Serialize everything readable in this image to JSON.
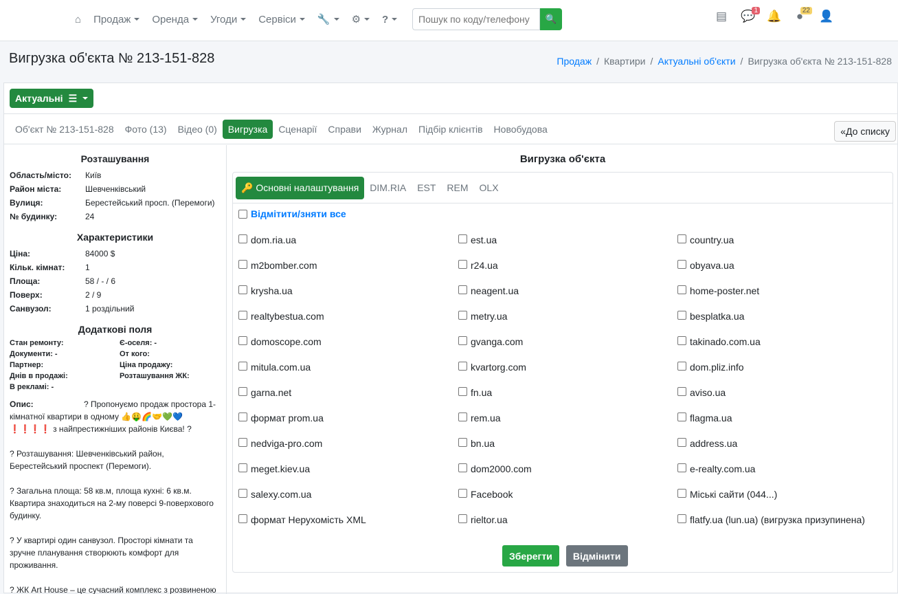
{
  "nav": {
    "items": [
      "Продаж",
      "Оренда",
      "Угоди",
      "Сервіси"
    ],
    "search_placeholder": "Пошук по коду/телефону",
    "messages_badge": "1",
    "tasks_badge": "22"
  },
  "page": {
    "title": "Вигрузка об'єкта № 213-151-828"
  },
  "breadcrumb": [
    "Продаж",
    "Квартири",
    "Актуальні об'єкти",
    "Вигрузка об'єкта № 213-151-828"
  ],
  "status_button": "Актуальні",
  "tabs": [
    "Об'єкт № 213-151-828",
    "Фото (13)",
    "Відео (0)",
    "Вигрузка",
    "Сценарії",
    "Справи",
    "Журнал",
    "Підбір клієнтів",
    "Новобудова"
  ],
  "back_button": "До списку",
  "left": {
    "location_title": "Розташування",
    "location": [
      [
        "Область/місто:",
        "Київ"
      ],
      [
        "Район міста:",
        "Шевченківський"
      ],
      [
        "Вулиця:",
        "Берестейський просп. (Перемоги)"
      ],
      [
        "№ будинку:",
        "24"
      ]
    ],
    "specs_title": "Характеристики",
    "specs": [
      [
        "Ціна:",
        "84000 $"
      ],
      [
        "Кільк. кімнат:",
        "1"
      ],
      [
        "Площа:",
        "58 / - / 6"
      ],
      [
        "Поверх:",
        "2 / 9"
      ],
      [
        "Санвузол:",
        "1 роздільний"
      ]
    ],
    "extra_title": "Додаткові поля",
    "extra": [
      "Стан ремонту:",
      "Є-оселя: -",
      "Документи: -",
      "От кого:",
      "Партнер:",
      "Ціна продажу:",
      "Днів в продажі:",
      "Розташування ЖК:",
      "В рекламі: -",
      ""
    ],
    "desc_label": "Опис:",
    "desc": [
      "? Пропонуємо продаж простора 1-кімнатної квартири в одному 👍🤑🌈🤝💚💙 ❗❗❗❗ з найпрестижніших районів Києва! ?",
      "? Розташування: Шевченківський район, Берестейський проспект (Перемоги).",
      "? Загальна площа: 58 кв.м, площа кухні: 6 кв.м. Квартира знаходиться на 2-му поверсі 9-поверхового будинку.",
      "? У квартирі один санвузол. Просторі кімнати та зручне планування створюють комфорт для проживання.",
      "? ЖК Art House – це сучасний комплекс з розвиненою інфраструктурою, що забезпечить вам"
    ]
  },
  "export": {
    "title": "Вигрузка об'єкта",
    "tabs": [
      "Основні налаштування",
      "DIM.RIA",
      "EST",
      "REM",
      "OLX"
    ],
    "select_all": "Відмітити/зняти все",
    "sites": [
      "dom.ria.ua",
      "est.ua",
      "country.ua",
      "m2bomber.com",
      "r24.ua",
      "obyava.ua",
      "krysha.ua",
      "neagent.ua",
      "home-poster.net",
      "realtybestua.com",
      "metry.ua",
      "besplatka.ua",
      "domoscope.com",
      "gvanga.com",
      "takinado.com.ua",
      "mitula.com.ua",
      "kvartorg.com",
      "dom.pliz.info",
      "garna.net",
      "fn.ua",
      "aviso.ua",
      "формат prom.ua",
      "rem.ua",
      "flagma.ua",
      "nedviga-pro.com",
      "bn.ua",
      "address.ua",
      "meget.kiev.ua",
      "dom2000.com",
      "e-realty.com.ua",
      "salexy.com.ua",
      "Facebook",
      "Міські сайти (044...)",
      "формат Нерухомість XML",
      "rieltor.ua",
      "flatfy.ua (lun.ua) (вигрузка призупинена)"
    ],
    "save": "Зберегти",
    "cancel": "Відмінити"
  }
}
